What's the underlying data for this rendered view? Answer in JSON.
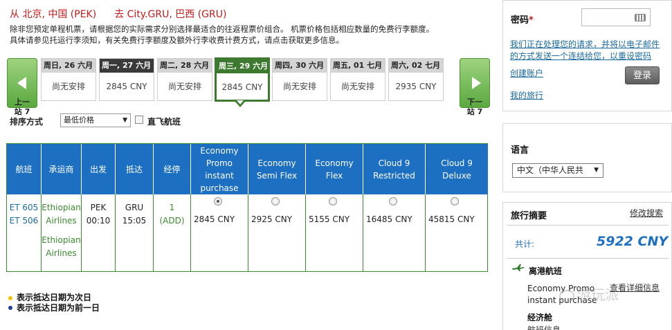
{
  "route": {
    "from": "从 北京, 中国 (PEK)",
    "to": "去 City.GRU, 巴西 (GRU)"
  },
  "notes": [
    "除非您预定单程机票，请根据您的实际需求分别选择最适合的往返程票价组合。 机票价格包括相应数量的免费行李额度。",
    "具体请参见托运行李须知，有关免费行李额度及额外行李收费计费方式，请点击获取更多信息。"
  ],
  "nav": {
    "prev_label": "上一站 7",
    "next_label": "下一站 7",
    "prev_a": "上一",
    "prev_b": "站 7",
    "next_a": "下一",
    "next_b": "站 7"
  },
  "dates": [
    {
      "day": "周日, 26 六月",
      "price": "尚无安排"
    },
    {
      "day": "周一, 27 六月",
      "price": "2845 CNY"
    },
    {
      "day": "周二, 28 六月",
      "price": "尚无安排"
    },
    {
      "day": "周三, 29 六月",
      "price": "2845 CNY"
    },
    {
      "day": "周四, 30 六月",
      "price": "尚无安排"
    },
    {
      "day": "周五, 01 七月",
      "price": "尚无安排"
    },
    {
      "day": "周六, 02 七月",
      "price": "2935 CNY"
    }
  ],
  "sort": {
    "label": "排序方式",
    "selected": "最低价格",
    "direct_label": "直飞航班"
  },
  "table": {
    "headers": [
      "航班",
      "承运商",
      "出发",
      "抵达",
      "经停",
      "Economy Promo instant purchase",
      "Economy Semi Flex",
      "Economy Flex",
      "Cloud 9 Restricted",
      "Cloud 9 Deluxe"
    ],
    "row": {
      "flights": [
        "ET 605",
        "ET 506"
      ],
      "carriers": [
        "Ethiopian Airlines",
        "Ethiopian Airlines"
      ],
      "carrier_lines": [
        "Ethiopian",
        "Airlines",
        "Ethiopian",
        "Airlines"
      ],
      "depart_code": "PEK",
      "depart_time": "00:10",
      "arrive_code": "GRU",
      "arrive_time": "15:05",
      "stops": "1",
      "stop_code": "(ADD)",
      "prices": [
        "2845 CNY",
        "2925 CNY",
        "5155 CNY",
        "16485 CNY",
        "45815 CNY"
      ]
    },
    "header_lines": [
      [
        "Economy",
        "Promo",
        "instant",
        "purchase"
      ],
      [
        "Economy",
        "Semi Flex"
      ],
      [
        "Economy",
        "Flex"
      ],
      [
        "Cloud 9",
        "Restricted"
      ],
      [
        "Cloud 9",
        "Deluxe"
      ]
    ]
  },
  "legend": [
    "表示抵达日期为次日",
    "表示抵达日期为前一日"
  ],
  "legend_colors": {
    "yellow": "#f2c200",
    "blue": "#1d3f9e"
  },
  "login": {
    "password_label": "密码",
    "required_mark": "*",
    "processing_text": "我们正在处理您的请求，并将以电子邮件的方式发送一个连结给您，以重设密码",
    "processing_lines": [
      "我们正在处理您的请求，并将以电子邮件",
      "的方式发送一个连结给您，以重设密码"
    ],
    "create_account": "创建账户",
    "login_button": "登录",
    "my_trips": "我的旅行"
  },
  "language": {
    "label": "语言",
    "selected": "中文（中华人民共"
  },
  "summary": {
    "title": "旅行摘要",
    "modify_link": "修改搜索",
    "total_label": "共计:",
    "total_value": "5922 CNY",
    "outbound_label": "离港航班",
    "fare_name": "Economy Promo instant purchase",
    "fare_lines": [
      "Economy Promo",
      "instant purchase"
    ],
    "details_link": "查看详细信息",
    "cabin_label": "经济舱",
    "cut_text": "航班信息"
  },
  "watermark": "游玩派",
  "colors": {
    "header_blue": "#1d6fc1",
    "border_green": "#3a8a2e",
    "selected_green": "#3d7a2f",
    "route_red": "#c41a1a",
    "link_blue": "#1a6a9e"
  }
}
